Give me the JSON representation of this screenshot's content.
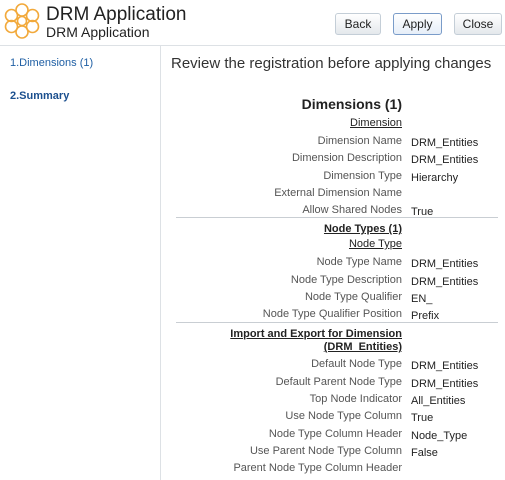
{
  "header": {
    "title": "DRM Application",
    "subtitle": "DRM Application",
    "buttons": {
      "back": "Back",
      "apply": "Apply",
      "close": "Close"
    }
  },
  "sidebar": {
    "items": [
      {
        "label": "1.Dimensions (1)"
      },
      {
        "label": "2.Summary"
      }
    ]
  },
  "main": {
    "heading": "Review the registration before applying changes",
    "section_title": "Dimensions (1)",
    "dimension": {
      "label": "Dimension",
      "rows": [
        {
          "label": "Dimension Name",
          "value": "DRM_Entities"
        },
        {
          "label": "Dimension Description",
          "value": "DRM_Entities"
        },
        {
          "label": "Dimension Type",
          "value": "Hierarchy"
        },
        {
          "label": "External Dimension Name",
          "value": ""
        },
        {
          "label": "Allow Shared Nodes",
          "value": "True"
        }
      ]
    },
    "node_types": {
      "title": "Node Types (1)",
      "label": "Node Type",
      "rows": [
        {
          "label": "Node Type Name",
          "value": "DRM_Entities"
        },
        {
          "label": "Node Type Description",
          "value": "DRM_Entities"
        },
        {
          "label": "Node Type Qualifier",
          "value": "EN_"
        },
        {
          "label": "Node Type Qualifier Position",
          "value": "Prefix"
        }
      ]
    },
    "import_export": {
      "title_line1": "Import and Export for Dimension",
      "title_line2": "(DRM_Entities)",
      "rows": [
        {
          "label": "Default Node Type",
          "value": "DRM_Entities"
        },
        {
          "label": "Default Parent Node Type",
          "value": "DRM_Entities"
        },
        {
          "label": "Top Node Indicator",
          "value": "All_Entities"
        },
        {
          "label": "Use Node Type Column",
          "value": "True"
        },
        {
          "label": "Node Type Column Header",
          "value": "Node_Type"
        },
        {
          "label": "Use Parent Node Type Column",
          "value": "False"
        },
        {
          "label": "Parent Node Type Column Header",
          "value": ""
        }
      ]
    }
  }
}
